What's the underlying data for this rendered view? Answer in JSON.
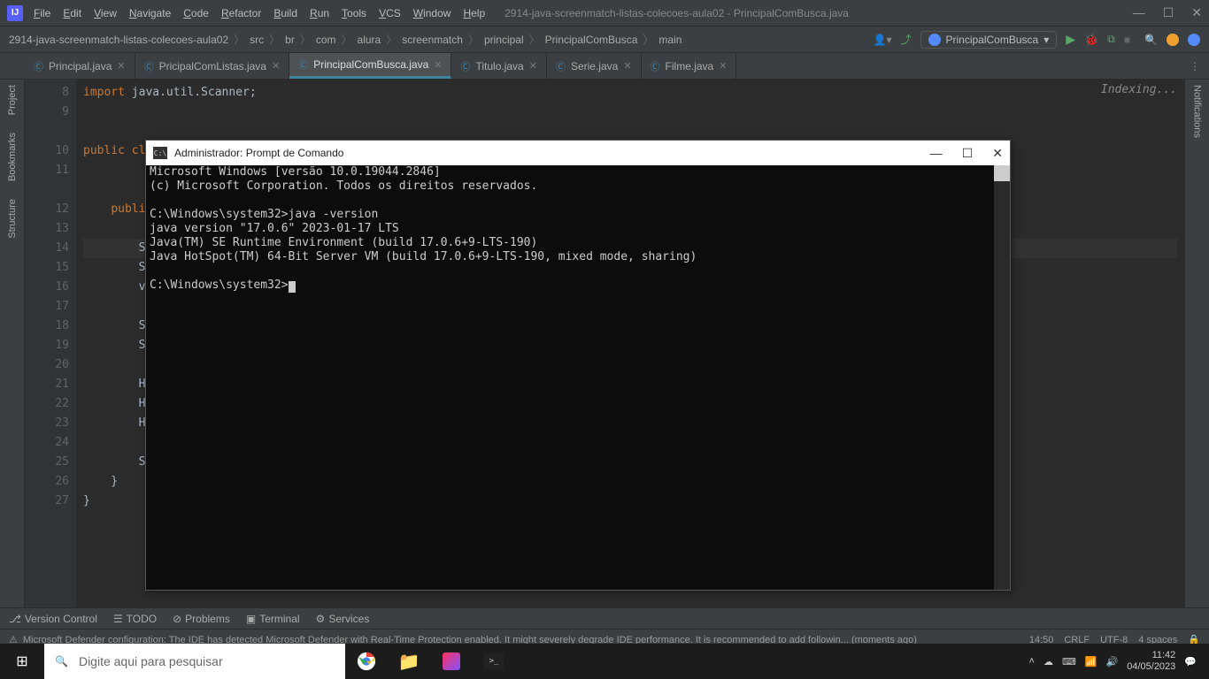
{
  "titlebar": {
    "menus": [
      "File",
      "Edit",
      "View",
      "Navigate",
      "Code",
      "Refactor",
      "Build",
      "Run",
      "Tools",
      "VCS",
      "Window",
      "Help"
    ],
    "title": "2914-java-screenmatch-listas-colecoes-aula02 - PrincipalComBusca.java"
  },
  "breadcrumbs": [
    "2914-java-screenmatch-listas-colecoes-aula02",
    "src",
    "br",
    "com",
    "alura",
    "screenmatch",
    "principal",
    "PrincipalComBusca",
    "main"
  ],
  "runconfig": "PrincipalComBusca",
  "tabs": [
    {
      "label": "Principal.java",
      "active": false
    },
    {
      "label": "PricipalComListas.java",
      "active": false
    },
    {
      "label": "PrincipalComBusca.java",
      "active": true
    },
    {
      "label": "Titulo.java",
      "active": false
    },
    {
      "label": "Serie.java",
      "active": false
    },
    {
      "label": "Filme.java",
      "active": false
    }
  ],
  "sidebars": {
    "left": [
      "Project",
      "Bookmarks",
      "Structure"
    ],
    "right": [
      "Notifications"
    ]
  },
  "editor": {
    "indexing": "Indexing...",
    "lines": [
      {
        "n": 8,
        "html": "<span class='kw'>import</span> java.util.Scanner;"
      },
      {
        "n": 9,
        "html": ""
      },
      {
        "n": "",
        "html": ""
      },
      {
        "n": 10,
        "html": "<span class='kw'>public class </span>"
      },
      {
        "n": 11,
        "html": ""
      },
      {
        "n": "",
        "html": ""
      },
      {
        "n": 12,
        "html": "    <span class='kw'>public</span>"
      },
      {
        "n": 13,
        "html": ""
      },
      {
        "n": 14,
        "html": "        Sc",
        "hl": true
      },
      {
        "n": 15,
        "html": "        Sy"
      },
      {
        "n": 16,
        "html": "        va"
      },
      {
        "n": 17,
        "html": ""
      },
      {
        "n": 18,
        "html": "        St"
      },
      {
        "n": 19,
        "html": "        St"
      },
      {
        "n": 20,
        "html": ""
      },
      {
        "n": 21,
        "html": "        Ht"
      },
      {
        "n": 22,
        "html": "        Ht"
      },
      {
        "n": 23,
        "html": "        Ht"
      },
      {
        "n": 24,
        "html": ""
      },
      {
        "n": 25,
        "html": "        Sy"
      },
      {
        "n": 26,
        "html": "    }"
      },
      {
        "n": 27,
        "html": "}"
      }
    ]
  },
  "bottombar": [
    "Version Control",
    "TODO",
    "Problems",
    "Terminal",
    "Services"
  ],
  "statusbar": {
    "msg": "Microsoft Defender configuration: The IDE has detected Microsoft Defender with Real-Time Protection enabled. It might severely degrade IDE performance. It is recommended to add followin... (moments ago)",
    "right": [
      "14:50",
      "CRLF",
      "UTF-8",
      "4 spaces"
    ]
  },
  "cmd": {
    "title": "Administrador: Prompt de Comando",
    "body": "Microsoft Windows [versão 10.0.19044.2846]\n(c) Microsoft Corporation. Todos os direitos reservados.\n\nC:\\Windows\\system32>java -version\njava version \"17.0.6\" 2023-01-17 LTS\nJava(TM) SE Runtime Environment (build 17.0.6+9-LTS-190)\nJava HotSpot(TM) 64-Bit Server VM (build 17.0.6+9-LTS-190, mixed mode, sharing)\n\nC:\\Windows\\system32>"
  },
  "taskbar": {
    "search_placeholder": "Digite aqui para pesquisar",
    "time": "11:42",
    "date": "04/05/2023"
  }
}
